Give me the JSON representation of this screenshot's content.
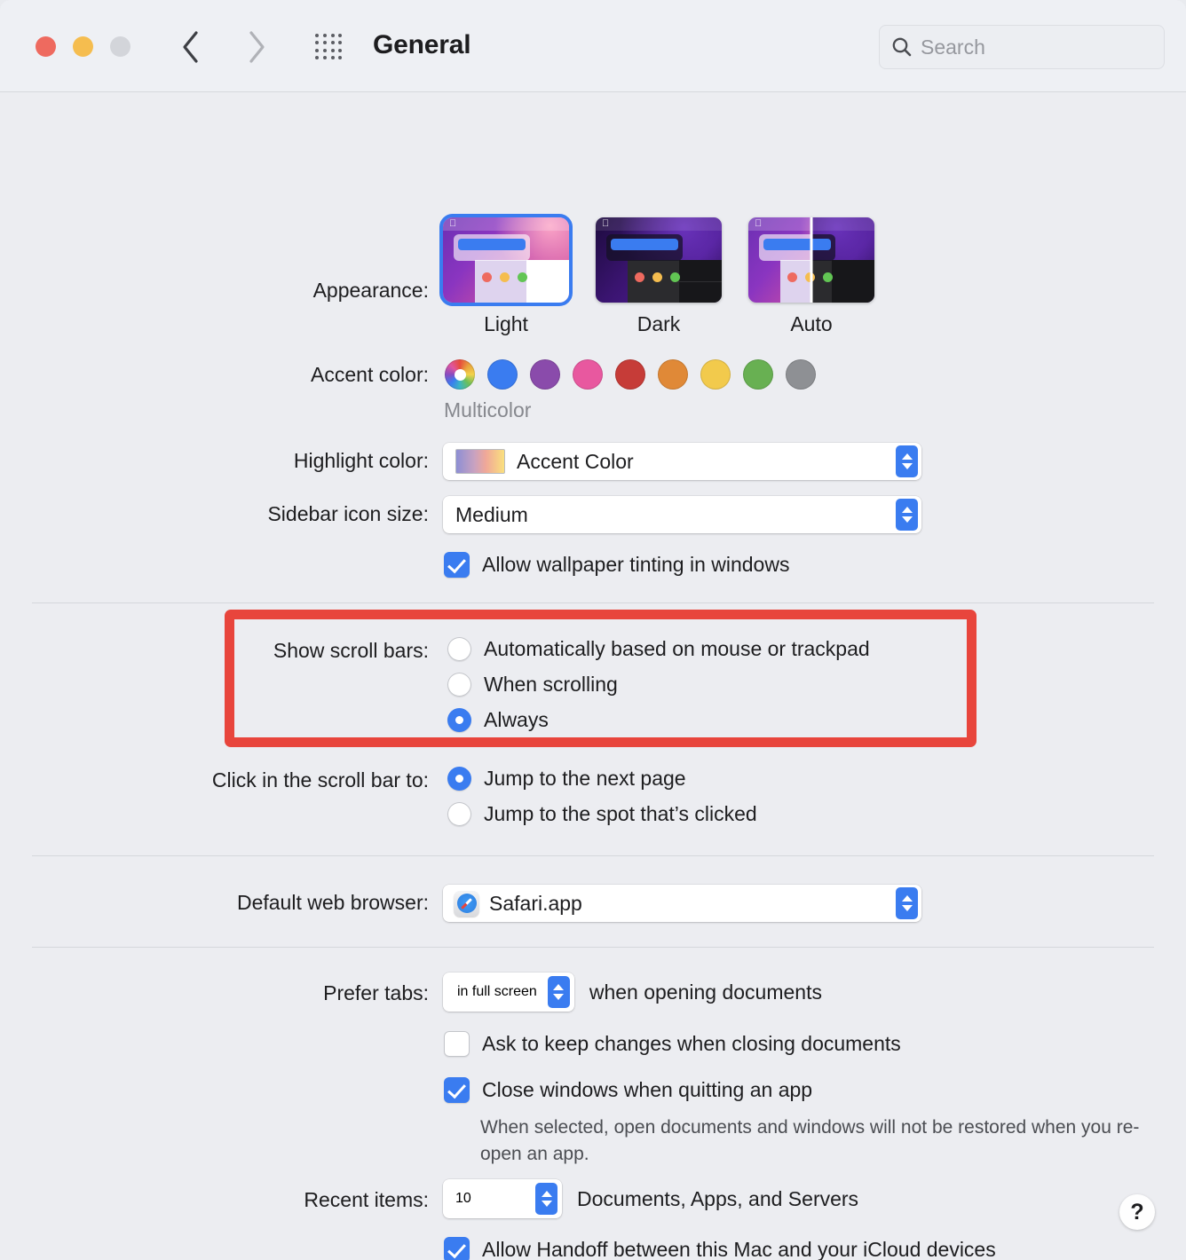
{
  "window": {
    "title": "General",
    "traffic_lights": [
      "close",
      "minimize",
      "zoom"
    ]
  },
  "toolbar": {
    "back_label": "Back",
    "forward_label": "Forward",
    "show_all_label": "Show All",
    "search": {
      "placeholder": "Search",
      "value": ""
    }
  },
  "appearance": {
    "label": "Appearance:",
    "options": [
      {
        "name": "Light",
        "selected": true
      },
      {
        "name": "Dark",
        "selected": false
      },
      {
        "name": "Auto",
        "selected": false
      }
    ]
  },
  "accent_color": {
    "label": "Accent color:",
    "selected_name": "Multicolor",
    "caption": "Multicolor",
    "swatches": [
      {
        "name": "Multicolor",
        "color": "multicolor",
        "selected": true
      },
      {
        "name": "Blue",
        "color": "#3a7cf0",
        "selected": false
      },
      {
        "name": "Purple",
        "color": "#8a4bab",
        "selected": false
      },
      {
        "name": "Pink",
        "color": "#e8589f",
        "selected": false
      },
      {
        "name": "Red",
        "color": "#c63c38",
        "selected": false
      },
      {
        "name": "Orange",
        "color": "#e08937",
        "selected": false
      },
      {
        "name": "Yellow",
        "color": "#f2ca4c",
        "selected": false
      },
      {
        "name": "Green",
        "color": "#68b052",
        "selected": false
      },
      {
        "name": "Graphite",
        "color": "#8e9094",
        "selected": false
      }
    ]
  },
  "highlight_color": {
    "label": "Highlight color:",
    "value": "Accent Color"
  },
  "sidebar_icon_size": {
    "label": "Sidebar icon size:",
    "value": "Medium"
  },
  "wallpaper_tinting": {
    "label": "Allow wallpaper tinting in windows",
    "checked": true
  },
  "show_scroll_bars": {
    "label": "Show scroll bars:",
    "options": [
      {
        "label": "Automatically based on mouse or trackpad",
        "selected": false
      },
      {
        "label": "When scrolling",
        "selected": false
      },
      {
        "label": "Always",
        "selected": true
      }
    ],
    "highlight_color": "#e8453c"
  },
  "click_scroll_bar": {
    "label": "Click in the scroll bar to:",
    "options": [
      {
        "label": "Jump to the next page",
        "selected": true
      },
      {
        "label": "Jump to the spot that’s clicked",
        "selected": false
      }
    ]
  },
  "default_web_browser": {
    "label": "Default web browser:",
    "value": "Safari.app",
    "icon": "safari-icon"
  },
  "prefer_tabs": {
    "label": "Prefer tabs:",
    "value": "in full screen",
    "suffix": "when opening documents"
  },
  "ask_keep_changes": {
    "label": "Ask to keep changes when closing documents",
    "checked": false
  },
  "close_windows": {
    "label": "Close windows when quitting an app",
    "checked": true,
    "description": "When selected, open documents and windows will not be restored when you re-open an app."
  },
  "recent_items": {
    "label": "Recent items:",
    "value": "10",
    "suffix": "Documents, Apps, and Servers"
  },
  "handoff": {
    "label": "Allow Handoff between this Mac and your iCloud devices",
    "checked": true
  },
  "help_button": {
    "label": "?"
  }
}
